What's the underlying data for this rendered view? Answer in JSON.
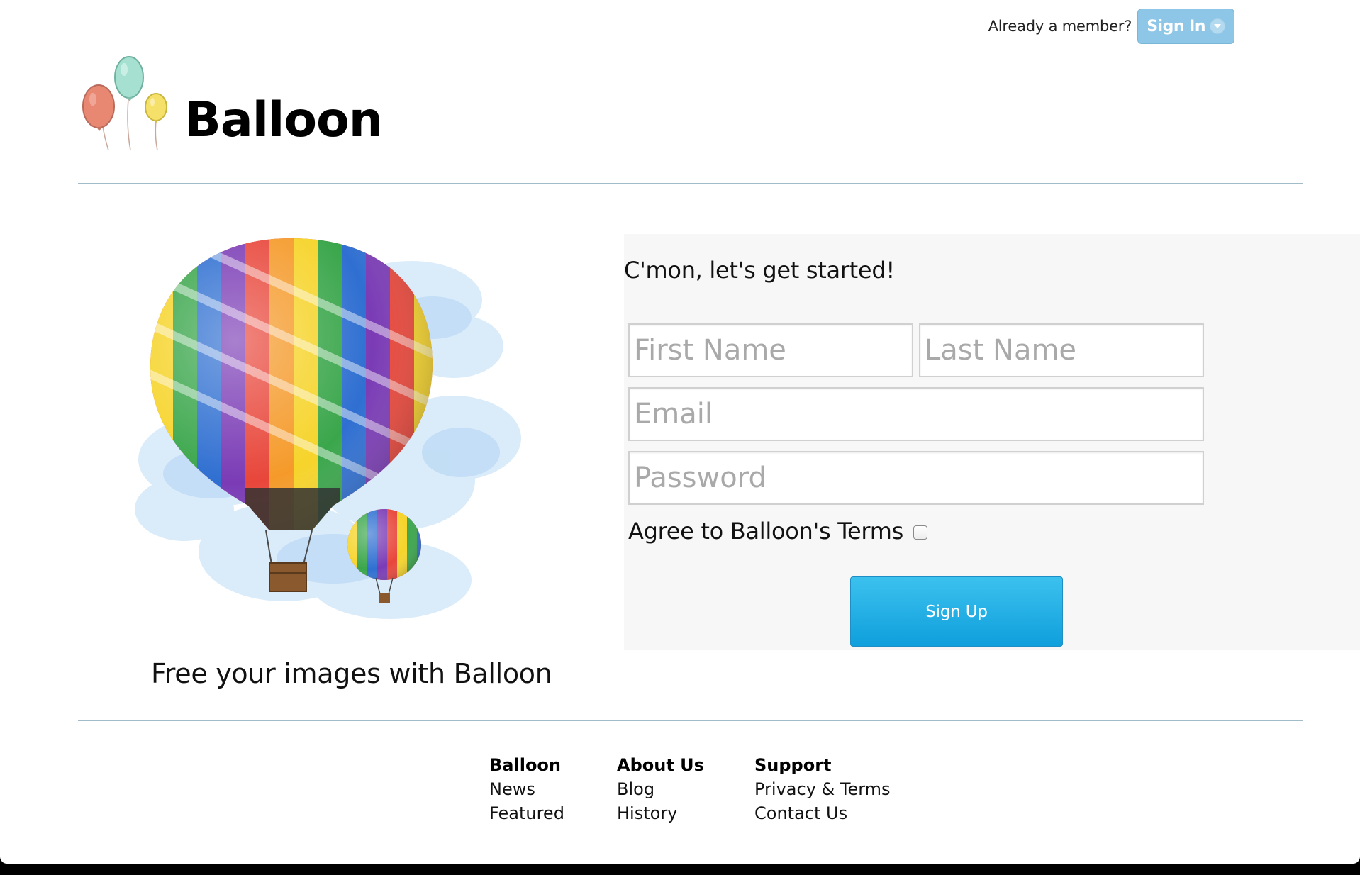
{
  "header": {
    "member_prompt": "Already a member?",
    "signin_label": "Sign In",
    "brand_name": "Balloon"
  },
  "hero": {
    "tagline": "Free your images with Balloon"
  },
  "signup": {
    "heading": "C'mon, let's get started!",
    "first_name_placeholder": "First Name",
    "last_name_placeholder": "Last Name",
    "email_placeholder": "Email",
    "password_placeholder": "Password",
    "terms_label": "Agree to Balloon's Terms",
    "terms_checked": false,
    "submit_label": "Sign Up"
  },
  "footer": {
    "columns": [
      {
        "heading": "Balloon",
        "links": [
          "News",
          "Featured"
        ]
      },
      {
        "heading": "About Us",
        "links": [
          "Blog",
          "History"
        ]
      },
      {
        "heading": "Support",
        "links": [
          "Privacy & Terms",
          "Contact Us"
        ]
      }
    ]
  },
  "colors": {
    "signin_bg": "#8dc6e6",
    "signup_button": "#0f9fdc",
    "divider": "#9fbcc8",
    "panel_bg": "#f7f7f7"
  },
  "icons": {
    "logo": "three-balloons-icon",
    "signin_dropdown": "chevron-down-icon",
    "hero": "hot-air-balloons-illustration"
  }
}
